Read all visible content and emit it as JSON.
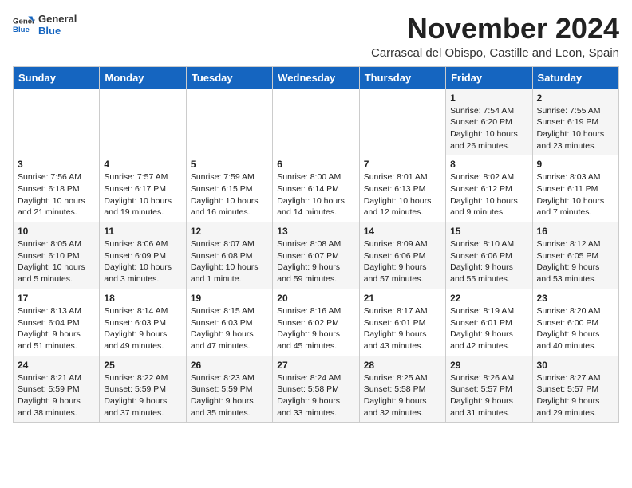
{
  "header": {
    "logo_general": "General",
    "logo_blue": "Blue",
    "month_year": "November 2024",
    "subtitle": "Carrascal del Obispo, Castille and Leon, Spain"
  },
  "days_of_week": [
    "Sunday",
    "Monday",
    "Tuesday",
    "Wednesday",
    "Thursday",
    "Friday",
    "Saturday"
  ],
  "weeks": [
    [
      {
        "day": "",
        "info": ""
      },
      {
        "day": "",
        "info": ""
      },
      {
        "day": "",
        "info": ""
      },
      {
        "day": "",
        "info": ""
      },
      {
        "day": "",
        "info": ""
      },
      {
        "day": "1",
        "info": "Sunrise: 7:54 AM\nSunset: 6:20 PM\nDaylight: 10 hours and 26 minutes."
      },
      {
        "day": "2",
        "info": "Sunrise: 7:55 AM\nSunset: 6:19 PM\nDaylight: 10 hours and 23 minutes."
      }
    ],
    [
      {
        "day": "3",
        "info": "Sunrise: 7:56 AM\nSunset: 6:18 PM\nDaylight: 10 hours and 21 minutes."
      },
      {
        "day": "4",
        "info": "Sunrise: 7:57 AM\nSunset: 6:17 PM\nDaylight: 10 hours and 19 minutes."
      },
      {
        "day": "5",
        "info": "Sunrise: 7:59 AM\nSunset: 6:15 PM\nDaylight: 10 hours and 16 minutes."
      },
      {
        "day": "6",
        "info": "Sunrise: 8:00 AM\nSunset: 6:14 PM\nDaylight: 10 hours and 14 minutes."
      },
      {
        "day": "7",
        "info": "Sunrise: 8:01 AM\nSunset: 6:13 PM\nDaylight: 10 hours and 12 minutes."
      },
      {
        "day": "8",
        "info": "Sunrise: 8:02 AM\nSunset: 6:12 PM\nDaylight: 10 hours and 9 minutes."
      },
      {
        "day": "9",
        "info": "Sunrise: 8:03 AM\nSunset: 6:11 PM\nDaylight: 10 hours and 7 minutes."
      }
    ],
    [
      {
        "day": "10",
        "info": "Sunrise: 8:05 AM\nSunset: 6:10 PM\nDaylight: 10 hours and 5 minutes."
      },
      {
        "day": "11",
        "info": "Sunrise: 8:06 AM\nSunset: 6:09 PM\nDaylight: 10 hours and 3 minutes."
      },
      {
        "day": "12",
        "info": "Sunrise: 8:07 AM\nSunset: 6:08 PM\nDaylight: 10 hours and 1 minute."
      },
      {
        "day": "13",
        "info": "Sunrise: 8:08 AM\nSunset: 6:07 PM\nDaylight: 9 hours and 59 minutes."
      },
      {
        "day": "14",
        "info": "Sunrise: 8:09 AM\nSunset: 6:06 PM\nDaylight: 9 hours and 57 minutes."
      },
      {
        "day": "15",
        "info": "Sunrise: 8:10 AM\nSunset: 6:06 PM\nDaylight: 9 hours and 55 minutes."
      },
      {
        "day": "16",
        "info": "Sunrise: 8:12 AM\nSunset: 6:05 PM\nDaylight: 9 hours and 53 minutes."
      }
    ],
    [
      {
        "day": "17",
        "info": "Sunrise: 8:13 AM\nSunset: 6:04 PM\nDaylight: 9 hours and 51 minutes."
      },
      {
        "day": "18",
        "info": "Sunrise: 8:14 AM\nSunset: 6:03 PM\nDaylight: 9 hours and 49 minutes."
      },
      {
        "day": "19",
        "info": "Sunrise: 8:15 AM\nSunset: 6:03 PM\nDaylight: 9 hours and 47 minutes."
      },
      {
        "day": "20",
        "info": "Sunrise: 8:16 AM\nSunset: 6:02 PM\nDaylight: 9 hours and 45 minutes."
      },
      {
        "day": "21",
        "info": "Sunrise: 8:17 AM\nSunset: 6:01 PM\nDaylight: 9 hours and 43 minutes."
      },
      {
        "day": "22",
        "info": "Sunrise: 8:19 AM\nSunset: 6:01 PM\nDaylight: 9 hours and 42 minutes."
      },
      {
        "day": "23",
        "info": "Sunrise: 8:20 AM\nSunset: 6:00 PM\nDaylight: 9 hours and 40 minutes."
      }
    ],
    [
      {
        "day": "24",
        "info": "Sunrise: 8:21 AM\nSunset: 5:59 PM\nDaylight: 9 hours and 38 minutes."
      },
      {
        "day": "25",
        "info": "Sunrise: 8:22 AM\nSunset: 5:59 PM\nDaylight: 9 hours and 37 minutes."
      },
      {
        "day": "26",
        "info": "Sunrise: 8:23 AM\nSunset: 5:59 PM\nDaylight: 9 hours and 35 minutes."
      },
      {
        "day": "27",
        "info": "Sunrise: 8:24 AM\nSunset: 5:58 PM\nDaylight: 9 hours and 33 minutes."
      },
      {
        "day": "28",
        "info": "Sunrise: 8:25 AM\nSunset: 5:58 PM\nDaylight: 9 hours and 32 minutes."
      },
      {
        "day": "29",
        "info": "Sunrise: 8:26 AM\nSunset: 5:57 PM\nDaylight: 9 hours and 31 minutes."
      },
      {
        "day": "30",
        "info": "Sunrise: 8:27 AM\nSunset: 5:57 PM\nDaylight: 9 hours and 29 minutes."
      }
    ]
  ]
}
